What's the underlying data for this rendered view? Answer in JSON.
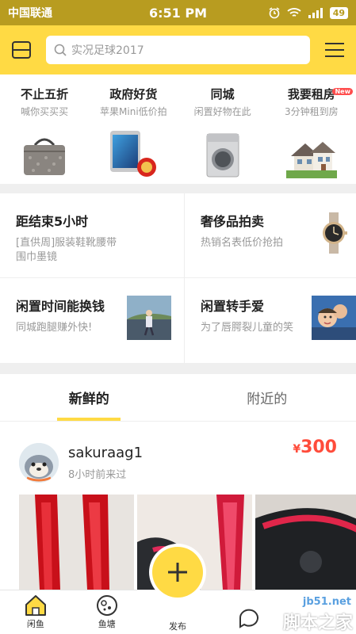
{
  "status": {
    "carrier": "中国联通",
    "time": "6:51 PM",
    "battery": "49"
  },
  "header": {
    "search_placeholder": "实况足球2017"
  },
  "categories": [
    {
      "title": "不止五折",
      "sub": "喊你买买买",
      "icon": "handbag-icon"
    },
    {
      "title": "政府好货",
      "sub": "苹果Mini低价拍",
      "icon": "ipad-icon"
    },
    {
      "title": "同城",
      "sub": "闲置好物在此",
      "icon": "washing-machine-icon"
    },
    {
      "title": "我要租房",
      "sub": "3分钟租到房",
      "icon": "house-icon",
      "badge": "New"
    }
  ],
  "grid": [
    {
      "title": "距结束5小时",
      "sub": "[直供周]服装鞋靴腰带围巾墨镜"
    },
    {
      "title": "奢侈品拍卖",
      "sub": "热销名表低价抢拍",
      "icon": "watch-icon"
    },
    {
      "title": "闲置时间能换钱",
      "sub": "同城跑腿赚外快!",
      "icon": "runner-photo"
    },
    {
      "title": "闲置转手爱",
      "sub": "为了唇腭裂儿童的笑",
      "icon": "child-photo"
    }
  ],
  "tabs": [
    {
      "label": "新鲜的",
      "active": true
    },
    {
      "label": "附近的",
      "active": false
    }
  ],
  "feed": {
    "username": "sakuraag1",
    "time": "8小时前来过",
    "currency": "¥",
    "price": "300"
  },
  "nav": {
    "home": "闲鱼",
    "pond": "鱼塘",
    "publish": "发布"
  },
  "watermark": {
    "url": "jb51.net",
    "text": "脚本之家"
  },
  "colors": {
    "accent": "#ffda44",
    "price": "#ff4c3b",
    "statusbar": "#b89c20"
  }
}
